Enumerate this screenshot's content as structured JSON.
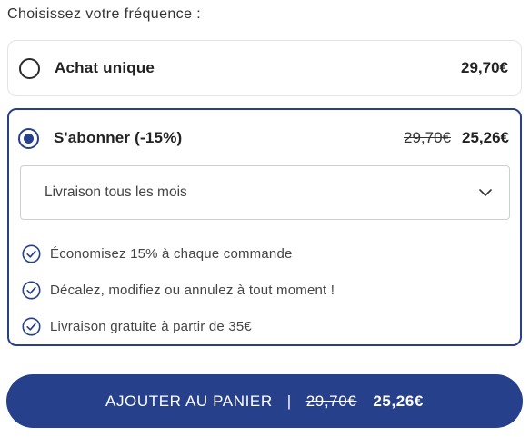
{
  "heading": "Choisissez votre fréquence :",
  "one_time": {
    "label": "Achat unique",
    "price": "29,70€",
    "selected": false
  },
  "subscription": {
    "label": "S'abonner (-15%)",
    "old_price": "29,70€",
    "new_price": "25,26€",
    "selected": true,
    "frequency_selected": "Livraison tous les mois",
    "benefits": [
      "Économisez 15% à chaque commande",
      "Décalez, modifiez ou annulez à tout moment !",
      "Livraison gratuite à partir de 35€"
    ]
  },
  "cta": {
    "label": "AJOUTER AU PANIER",
    "separator": "|",
    "old_price": "29,70€",
    "new_price": "25,26€"
  },
  "colors": {
    "accent": "#27408b",
    "border": "#e4e4e4"
  },
  "icons": {
    "radio": "radio-icon",
    "chevron": "chevron-down-icon",
    "check": "check-circle-icon"
  }
}
